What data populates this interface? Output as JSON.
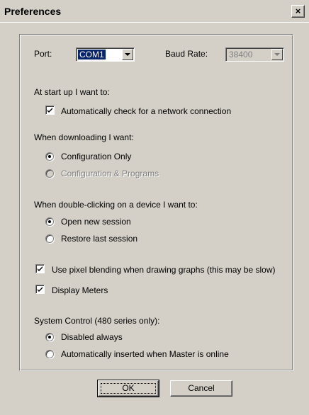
{
  "window": {
    "title": "Preferences",
    "close_glyph": "×"
  },
  "port": {
    "label": "Port:",
    "value": "COM1"
  },
  "baud": {
    "label": "Baud Rate:",
    "value": "38400"
  },
  "startup": {
    "heading": "At start up I want to:",
    "auto_check_label": "Automatically check for a network connection",
    "auto_check_checked": true
  },
  "download": {
    "heading": "When downloading I want:",
    "options": [
      {
        "label": "Configuration Only",
        "selected": true,
        "disabled": false
      },
      {
        "label": "Configuration & Programs",
        "selected": false,
        "disabled": true
      }
    ]
  },
  "doubleclick": {
    "heading": "When double-clicking on a device I want to:",
    "options": [
      {
        "label": "Open new session",
        "selected": true
      },
      {
        "label": "Restore last session",
        "selected": false
      }
    ]
  },
  "pixel_blending": {
    "label": "Use pixel blending when drawing graphs (this may be slow)",
    "checked": true
  },
  "display_meters": {
    "label": "Display Meters",
    "checked": true
  },
  "system_control": {
    "heading": "System Control (480 series only):",
    "options": [
      {
        "label": "Disabled always",
        "selected": true
      },
      {
        "label": "Automatically inserted when Master is online",
        "selected": false
      }
    ]
  },
  "buttons": {
    "ok": "OK",
    "cancel": "Cancel"
  }
}
